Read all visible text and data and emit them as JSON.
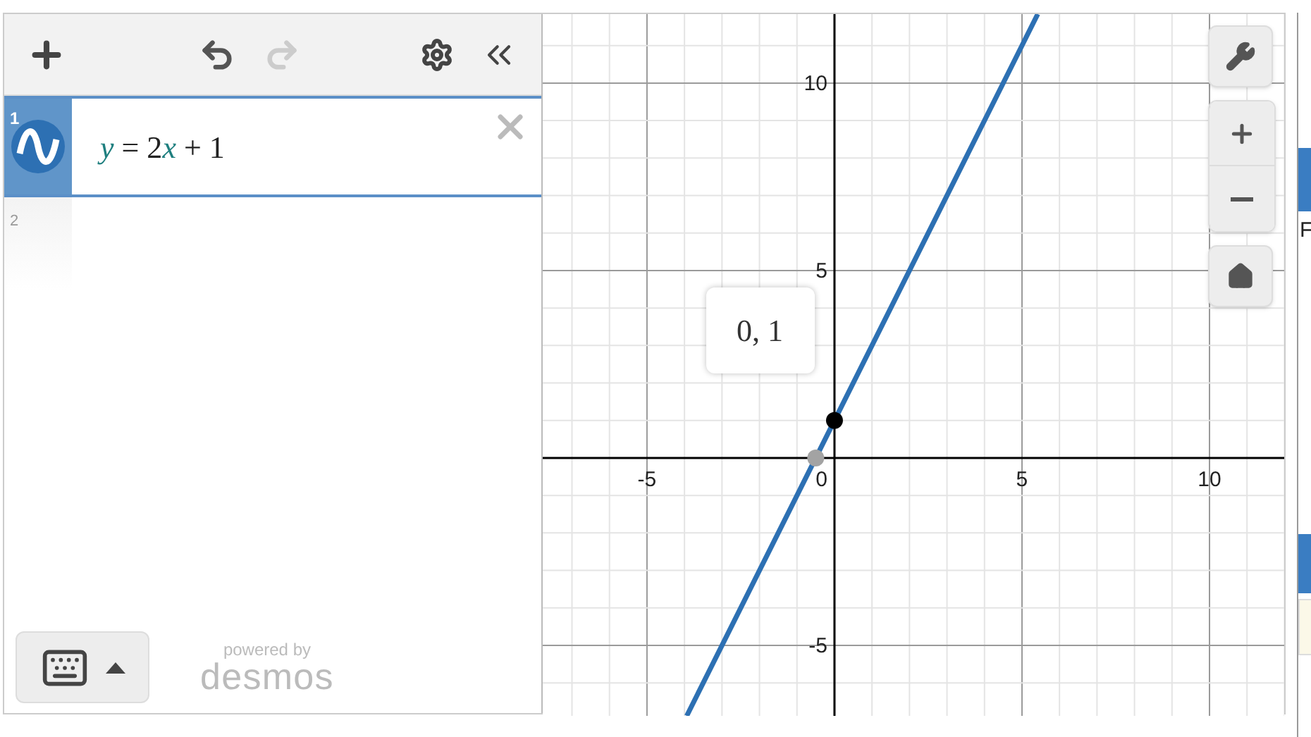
{
  "toolbar": {
    "undo_enabled": true,
    "redo_enabled": false
  },
  "expressions": [
    {
      "index": "1",
      "selected": true,
      "kind": "graphed",
      "tokens": [
        {
          "text": "y",
          "kind": "variable"
        },
        {
          "text": " = 2",
          "kind": "plain"
        },
        {
          "text": "x",
          "kind": "variable"
        },
        {
          "text": " + 1",
          "kind": "plain"
        }
      ]
    },
    {
      "index": "2",
      "selected": false,
      "kind": "empty"
    }
  ],
  "branding": {
    "line_1": "powered by",
    "line_2": "desmos"
  },
  "graph": {
    "origin_label": "0",
    "x_intercept_marked": true,
    "chart_data": {
      "type": "line",
      "grid": true,
      "x": [
        -3.94,
        5.42
      ],
      "series": [
        {
          "color": "#2d70b3",
          "values": [
            -6.88,
            11.84
          ]
        }
      ],
      "xlim": [
        -7.78,
        12.03
      ],
      "ylim": [
        -6.88,
        11.84
      ],
      "xticks": [
        -5,
        5,
        10
      ],
      "yticks": [
        -5,
        5,
        10
      ],
      "annotations": [
        {
          "x": 0,
          "y": 1,
          "text": "0, 1"
        }
      ]
    }
  },
  "page_edge": {
    "text": "F"
  }
}
